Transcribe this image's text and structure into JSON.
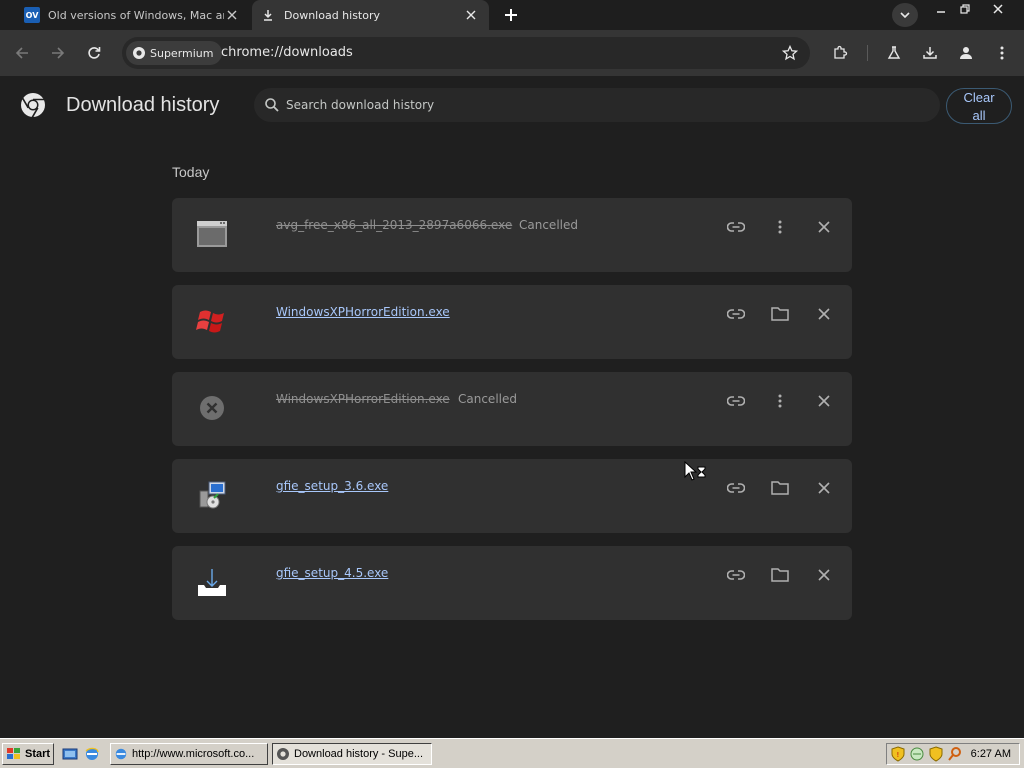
{
  "tabs": [
    {
      "title": "Old versions of Windows, Mac and Linux",
      "favicon": "OV",
      "active": false
    },
    {
      "title": "Download history",
      "active": true
    }
  ],
  "omnibox": {
    "site_chip": "Supermium",
    "url": "chrome://downloads"
  },
  "page": {
    "title": "Download history",
    "search_placeholder": "Search download history",
    "clear_all_label": "Clear all",
    "section_label": "Today"
  },
  "downloads": [
    {
      "filename": "avg_free_x86_all_2013_2897a6066.exe",
      "status": "Cancelled",
      "icon": "window-file-icon",
      "cancelled": true
    },
    {
      "filename": "WindowsXPHorrorEdition.exe",
      "status": "",
      "icon": "windows-flag-icon",
      "cancelled": false
    },
    {
      "filename": "WindowsXPHorrorEdition.exe",
      "status": "Cancelled",
      "icon": "cancelled-x-icon",
      "cancelled": true
    },
    {
      "filename": "gfie_setup_3.6.exe",
      "status": "",
      "icon": "installer-icon",
      "cancelled": false
    },
    {
      "filename": "gfie_setup_4.5.exe",
      "status": "",
      "icon": "download-tray-icon",
      "cancelled": false
    }
  ],
  "taskbar": {
    "start_label": "Start",
    "tasks": [
      {
        "label": "http://www.microsoft.co...",
        "active": false
      },
      {
        "label": "Download history - Supe...",
        "active": true
      }
    ],
    "clock": "6:27 AM"
  },
  "colors": {
    "accent_link": "#a8c7fa",
    "background": "#1f1f1f",
    "card": "#303030"
  }
}
